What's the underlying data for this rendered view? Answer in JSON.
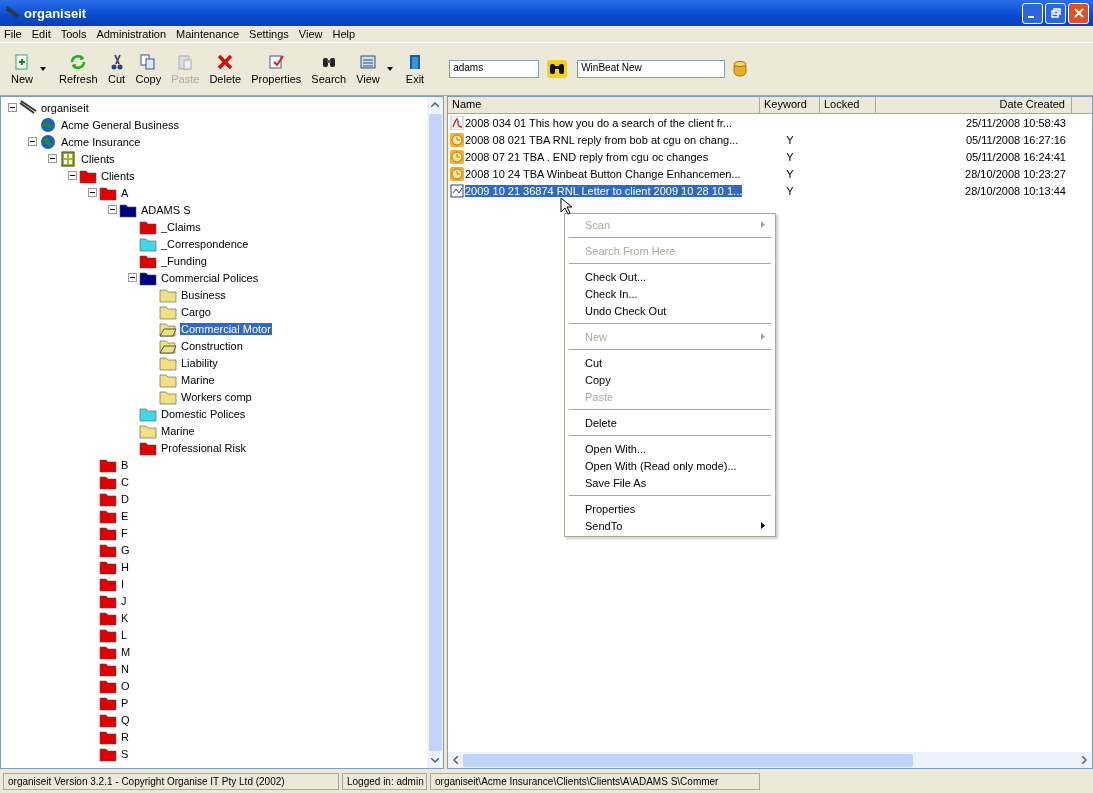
{
  "window": {
    "title": "organiseit"
  },
  "menu": [
    "File",
    "Edit",
    "Tools",
    "Administration",
    "Maintenance",
    "Settings",
    "View",
    "Help"
  ],
  "toolbar": [
    {
      "kind": "new",
      "label": "New",
      "dropdown": true,
      "disabled": false
    },
    {
      "kind": "refresh",
      "label": "Refresh",
      "dropdown": false,
      "disabled": false
    },
    {
      "kind": "cut",
      "label": "Cut",
      "dropdown": false,
      "disabled": false
    },
    {
      "kind": "copy",
      "label": "Copy",
      "dropdown": false,
      "disabled": false
    },
    {
      "kind": "paste",
      "label": "Paste",
      "dropdown": false,
      "disabled": true
    },
    {
      "kind": "delete",
      "label": "Delete",
      "dropdown": false,
      "disabled": false
    },
    {
      "kind": "properties",
      "label": "Properties",
      "dropdown": false,
      "disabled": false
    },
    {
      "kind": "search",
      "label": "Search",
      "dropdown": false,
      "disabled": false
    },
    {
      "kind": "view",
      "label": "View",
      "dropdown": true,
      "disabled": false
    },
    {
      "kind": "exit",
      "label": "Exit",
      "dropdown": false,
      "disabled": false
    }
  ],
  "search_field": {
    "value": "adams"
  },
  "profile_field": {
    "value": "WinBeat New"
  },
  "tree": [
    {
      "label": "organiseit",
      "kind": "root",
      "expanded": true,
      "selected": false,
      "children": [
        {
          "label": "Acme General Business",
          "kind": "globe",
          "selected": false
        },
        {
          "label": "Acme Insurance",
          "kind": "globe",
          "expanded": true,
          "selected": false,
          "children": [
            {
              "label": "Clients",
              "kind": "cabinet",
              "expanded": true,
              "selected": false,
              "children": [
                {
                  "label": "Clients",
                  "kind": "folder",
                  "color": "#e00000",
                  "expanded": true,
                  "selected": false,
                  "children": [
                    {
                      "label": "A",
                      "kind": "folder",
                      "color": "#e00000",
                      "expanded": true,
                      "selected": false,
                      "children": [
                        {
                          "label": "ADAMS S",
                          "kind": "folder",
                          "color": "#000080",
                          "expanded": true,
                          "selected": false,
                          "children": [
                            {
                              "label": "_Claims",
                              "kind": "folder",
                              "color": "#e00000",
                              "selected": false
                            },
                            {
                              "label": "_Correspondence",
                              "kind": "folder",
                              "color": "#40d8e8",
                              "selected": false
                            },
                            {
                              "label": "_Funding",
                              "kind": "folder",
                              "color": "#e00000",
                              "selected": false
                            },
                            {
                              "label": "Commercial Polices",
                              "kind": "folder",
                              "color": "#000080",
                              "expanded": true,
                              "selected": false,
                              "children": [
                                {
                                  "label": "Business",
                                  "kind": "folder",
                                  "color": "#f0e080",
                                  "selected": false
                                },
                                {
                                  "label": "Cargo",
                                  "kind": "folder",
                                  "color": "#f0e080",
                                  "selected": false
                                },
                                {
                                  "label": "Commercial Motor",
                                  "kind": "open-folder",
                                  "color": "#f0e080",
                                  "selected": true
                                },
                                {
                                  "label": "Construction",
                                  "kind": "open-folder",
                                  "color": "#f0e080",
                                  "selected": false
                                },
                                {
                                  "label": "Liability",
                                  "kind": "folder",
                                  "color": "#f0e080",
                                  "selected": false
                                },
                                {
                                  "label": "Marine",
                                  "kind": "folder",
                                  "color": "#f0e080",
                                  "selected": false
                                },
                                {
                                  "label": "Workers comp",
                                  "kind": "folder",
                                  "color": "#f0e080",
                                  "selected": false
                                }
                              ]
                            },
                            {
                              "label": "Domestic Polices",
                              "kind": "folder",
                              "color": "#40d8e8",
                              "selected": false
                            },
                            {
                              "label": "Marine",
                              "kind": "folder",
                              "color": "#f0e080",
                              "selected": false
                            },
                            {
                              "label": "Professional Risk",
                              "kind": "folder",
                              "color": "#e00000",
                              "selected": false
                            }
                          ]
                        }
                      ]
                    },
                    {
                      "label": "B",
                      "kind": "folder",
                      "color": "#e00000",
                      "selected": false
                    },
                    {
                      "label": "C",
                      "kind": "folder",
                      "color": "#e00000",
                      "selected": false
                    },
                    {
                      "label": "D",
                      "kind": "folder",
                      "color": "#e00000",
                      "selected": false
                    },
                    {
                      "label": "E",
                      "kind": "folder",
                      "color": "#e00000",
                      "selected": false
                    },
                    {
                      "label": "F",
                      "kind": "folder",
                      "color": "#e00000",
                      "selected": false
                    },
                    {
                      "label": "G",
                      "kind": "folder",
                      "color": "#e00000",
                      "selected": false
                    },
                    {
                      "label": "H",
                      "kind": "folder",
                      "color": "#e00000",
                      "selected": false
                    },
                    {
                      "label": "I",
                      "kind": "folder",
                      "color": "#e00000",
                      "selected": false
                    },
                    {
                      "label": "J",
                      "kind": "folder",
                      "color": "#e00000",
                      "selected": false
                    },
                    {
                      "label": "K",
                      "kind": "folder",
                      "color": "#e00000",
                      "selected": false
                    },
                    {
                      "label": "L",
                      "kind": "folder",
                      "color": "#e00000",
                      "selected": false
                    },
                    {
                      "label": "M",
                      "kind": "folder",
                      "color": "#e00000",
                      "selected": false
                    },
                    {
                      "label": "N",
                      "kind": "folder",
                      "color": "#e00000",
                      "selected": false
                    },
                    {
                      "label": "O",
                      "kind": "folder",
                      "color": "#e00000",
                      "selected": false
                    },
                    {
                      "label": "P",
                      "kind": "folder",
                      "color": "#e00000",
                      "selected": false
                    },
                    {
                      "label": "Q",
                      "kind": "folder",
                      "color": "#e00000",
                      "selected": false
                    },
                    {
                      "label": "R",
                      "kind": "folder",
                      "color": "#e00000",
                      "selected": false
                    },
                    {
                      "label": "S",
                      "kind": "folder",
                      "color": "#e00000",
                      "selected": false
                    }
                  ]
                }
              ]
            }
          ]
        }
      ]
    }
  ],
  "table": {
    "columns": [
      "Name",
      "Keyword",
      "Locked",
      "Date Created"
    ],
    "rows": [
      {
        "kind": "pdf",
        "name": "2008 034 01  This how you do a search of the client fr...",
        "keyword": "",
        "locked": "",
        "date": "25/11/2008 10:58:43",
        "selected": false
      },
      {
        "kind": "clock",
        "name": "2008 08 021  TBA RNL reply from bob at cgu on chang...",
        "keyword": "Y",
        "locked": "",
        "date": "05/11/2008 16:27:16",
        "selected": false
      },
      {
        "kind": "clock",
        "name": "2008 07 21  TBA . END reply from cgu oc changes",
        "keyword": "Y",
        "locked": "",
        "date": "05/11/2008 16:24:41",
        "selected": false
      },
      {
        "kind": "clock",
        "name": "2008 10 24  TBA Winbeat Button Change Enhancemen...",
        "keyword": "Y",
        "locked": "",
        "date": "28/10/2008 10:23:27",
        "selected": false
      },
      {
        "kind": "doc",
        "name": "2009 10 21 36874 RNL Letter to client 2009 10 28 10 1...",
        "keyword": "Y",
        "locked": "",
        "date": "28/10/2008 10:13:44",
        "selected": true
      }
    ]
  },
  "context_menu": [
    [
      {
        "label": "Scan",
        "disabled": true,
        "submenu": true
      }
    ],
    [
      {
        "label": "Search From Here",
        "disabled": true,
        "submenu": false
      }
    ],
    [
      {
        "label": "Check Out...",
        "disabled": false,
        "submenu": false
      },
      {
        "label": "Check In...",
        "disabled": false,
        "submenu": false
      },
      {
        "label": "Undo Check Out",
        "disabled": false,
        "submenu": false
      }
    ],
    [
      {
        "label": "New",
        "disabled": true,
        "submenu": true
      }
    ],
    [
      {
        "label": "Cut",
        "disabled": false,
        "submenu": false
      },
      {
        "label": "Copy",
        "disabled": false,
        "submenu": false
      },
      {
        "label": "Paste",
        "disabled": true,
        "submenu": false
      }
    ],
    [
      {
        "label": "Delete",
        "disabled": false,
        "submenu": false
      }
    ],
    [
      {
        "label": "Open With...",
        "disabled": false,
        "submenu": false
      },
      {
        "label": "Open With (Read only mode)...",
        "disabled": false,
        "submenu": false
      },
      {
        "label": "Save File As",
        "disabled": false,
        "submenu": false
      }
    ],
    [
      {
        "label": "Properties",
        "disabled": false,
        "submenu": false
      },
      {
        "label": "SendTo",
        "disabled": false,
        "submenu": true
      }
    ]
  ],
  "status_bar": [
    "organiseit Version 3.2.1 - Copyright Organise IT Pty Ltd (2002)",
    "Logged in: admin",
    "organiseit\\Acme Insurance\\Clients\\Clients\\A\\ADAMS S\\Commer"
  ]
}
